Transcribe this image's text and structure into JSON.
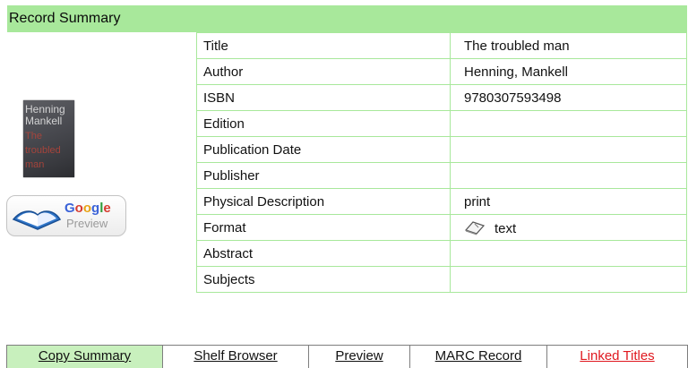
{
  "header": {
    "title": "Record Summary"
  },
  "cover": {
    "lines": [
      "Henning",
      "Mankell",
      "The",
      "troubled",
      "man"
    ]
  },
  "google_preview": {
    "brand": "Google",
    "label": "Preview"
  },
  "record": {
    "rows": [
      {
        "label": "Title",
        "value": "The troubled man"
      },
      {
        "label": "Author",
        "value": "Henning, Mankell"
      },
      {
        "label": "ISBN",
        "value": "9780307593498"
      },
      {
        "label": "Edition",
        "value": ""
      },
      {
        "label": "Publication Date",
        "value": ""
      },
      {
        "label": "Publisher",
        "value": ""
      },
      {
        "label": "Physical Description",
        "value": "print"
      },
      {
        "label": "Format",
        "value": "text",
        "icon": "open-book-icon"
      },
      {
        "label": "Abstract",
        "value": ""
      },
      {
        "label": "Subjects",
        "value": ""
      }
    ]
  },
  "tabs": [
    {
      "label": "Copy Summary",
      "active": true
    },
    {
      "label": "Shelf Browser"
    },
    {
      "label": "Preview"
    },
    {
      "label": "MARC Record"
    },
    {
      "label": "Linked Titles",
      "color": "#e0181f"
    }
  ],
  "colors": {
    "accent": "#a8e89b",
    "active_tab": "#c8f0bd",
    "link_red": "#e0181f"
  }
}
